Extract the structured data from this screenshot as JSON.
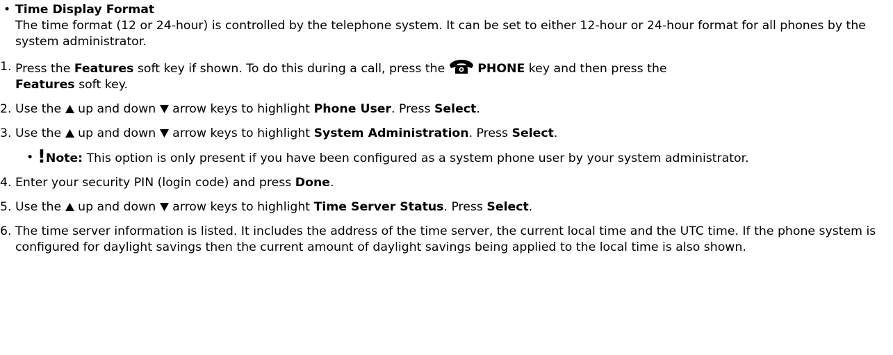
{
  "time_display": {
    "heading": "Time Display Format",
    "description": "The time format (12 or 24-hour) is controlled by the telephone system. It can be set to either 12-hour or 24-hour format for all phones by the system administrator."
  },
  "steps": {
    "s1": {
      "num": "1.",
      "t1": "Press the ",
      "b1": "Features",
      "t2": " soft key if shown. To do this during a call, press the ",
      "b2": "PHONE",
      "t3": " key and then press the ",
      "b3": "Features",
      "t4": " soft key."
    },
    "s2": {
      "num": "2.",
      "t1": "Use the ",
      "t2": " up and down ",
      "t3": " arrow keys to highlight ",
      "b1": "Phone User",
      "t4": ". Press ",
      "b2": "Select",
      "t5": "."
    },
    "s3": {
      "num": "3.",
      "t1": "Use the ",
      "t2": " up and down ",
      "t3": " arrow keys to highlight ",
      "b1": "System Administration",
      "t4": ". Press ",
      "b2": "Select",
      "t5": "."
    },
    "note": {
      "bang": "!",
      "label": "Note:",
      "text": " This option is only present if you have been configured as a system phone user by your system administrator."
    },
    "s4": {
      "num": "4.",
      "t1": "Enter your security PIN (login code) and press ",
      "b1": "Done",
      "t2": "."
    },
    "s5": {
      "num": "5.",
      "t1": "Use the ",
      "t2": " up and down ",
      "t3": " arrow keys to highlight ",
      "b1": "Time Server Status",
      "t4": ". Press ",
      "b2": "Select",
      "t5": "."
    },
    "s6": {
      "num": "6.",
      "text": "The time server information is listed. It includes the address of the time server, the current local time and the UTC time. If the phone system is configured for daylight savings then the current amount of daylight savings being applied to the local time is also shown."
    }
  },
  "icons": {
    "phone": "phone-key-icon",
    "up": "up-arrow-icon",
    "down": "down-arrow-icon",
    "bullet": "bullet-icon"
  }
}
